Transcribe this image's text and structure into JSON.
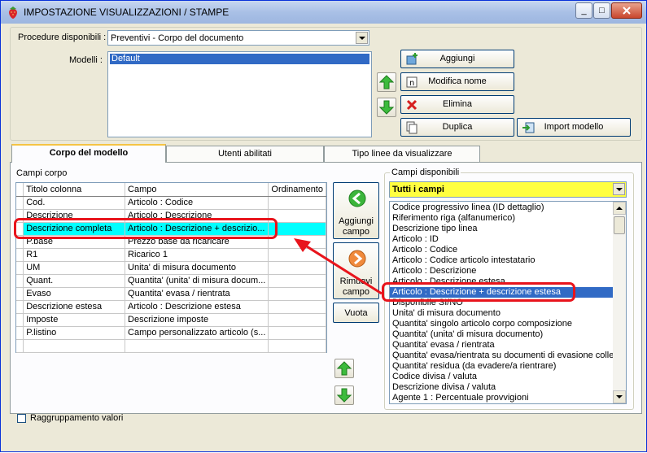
{
  "window": {
    "title": "IMPOSTAZIONE VISUALIZZAZIONI / STAMPE",
    "minimize": "_",
    "maximize": "□",
    "close": "×"
  },
  "procedure": {
    "label": "Procedure disponibili :",
    "value": "Preventivi - Corpo del documento"
  },
  "modelli": {
    "label": "Modelli :",
    "items": [
      "Default"
    ]
  },
  "buttons": {
    "aggiungi": "Aggiungi",
    "modifica": "Modifica nome",
    "elimina": "Elimina",
    "duplica": "Duplica",
    "import": "Import modello"
  },
  "tabs": [
    "Corpo del modello",
    "Utenti abilitati",
    "Tipo linee da visualizzare"
  ],
  "campi_corpo": {
    "label": "Campi corpo",
    "columns": [
      "Titolo colonna",
      "Campo",
      "Ordinamento"
    ],
    "rows": [
      {
        "titolo": "Cod.",
        "campo": "Articolo : Codice",
        "ord": ""
      },
      {
        "titolo": "Descrizione",
        "campo": "Articolo : Descrizione",
        "ord": ""
      },
      {
        "titolo": "Descrizione completa",
        "campo": "Articolo : Descrizione + descrizio...",
        "ord": ""
      },
      {
        "titolo": "P.base",
        "campo": "Prezzo base da ricaricare",
        "ord": ""
      },
      {
        "titolo": "R1",
        "campo": "Ricarico 1",
        "ord": ""
      },
      {
        "titolo": "UM",
        "campo": "Unita' di misura documento",
        "ord": ""
      },
      {
        "titolo": "Quant.",
        "campo": "Quantita' (unita' di misura docum...",
        "ord": ""
      },
      {
        "titolo": "Evaso",
        "campo": "Quantita' evasa / rientrata",
        "ord": ""
      },
      {
        "titolo": "Descrizione estesa",
        "campo": "Articolo : Descrizione estesa",
        "ord": ""
      },
      {
        "titolo": "Imposte",
        "campo": "Descrizione imposte",
        "ord": ""
      },
      {
        "titolo": "P.listino",
        "campo": "Campo personalizzato articolo (s...",
        "ord": ""
      },
      {
        "titolo": "",
        "campo": "",
        "ord": ""
      }
    ]
  },
  "middle_buttons": {
    "aggiungi_campo": [
      "Aggiungi",
      "campo"
    ],
    "rimuovi_campo": [
      "Rimuovi",
      "campo"
    ],
    "vuota": "Vuota"
  },
  "campi_disponibili": {
    "label": "Campi disponibili",
    "filter": "Tutti i campi",
    "items": [
      "Codice progressivo linea (ID dettaglio)",
      "Riferimento riga (alfanumerico)",
      "Descrizione tipo linea",
      "Articolo : ID",
      "Articolo : Codice",
      "Articolo : Codice articolo intestatario",
      "Articolo : Descrizione",
      "Articolo : Descrizione estesa",
      "Articolo : Descrizione + descrizione estesa",
      "Disponibile SI/NO",
      "Unita' di misura documento",
      "Quantita' singolo articolo corpo composizione",
      "Quantita' (unita' di misura documento)",
      "Quantita' evasa / rientrata",
      "Quantita' evasa/rientrata su documenti di evasione colleg",
      "Quantita' residua (da evadere/a rientrare)",
      "Codice divisa / valuta",
      "Descrizione divisa / valuta",
      "Agente 1 : Percentuale provvigioni"
    ],
    "selected_index": 8
  },
  "raggruppamento": {
    "label": "Raggruppamento valori",
    "checked": false
  },
  "colors": {
    "highlight_row": "#00ffff",
    "list_selection": "#316ac5",
    "filter_bg": "#ffff40",
    "annotation": "#e8141c"
  }
}
